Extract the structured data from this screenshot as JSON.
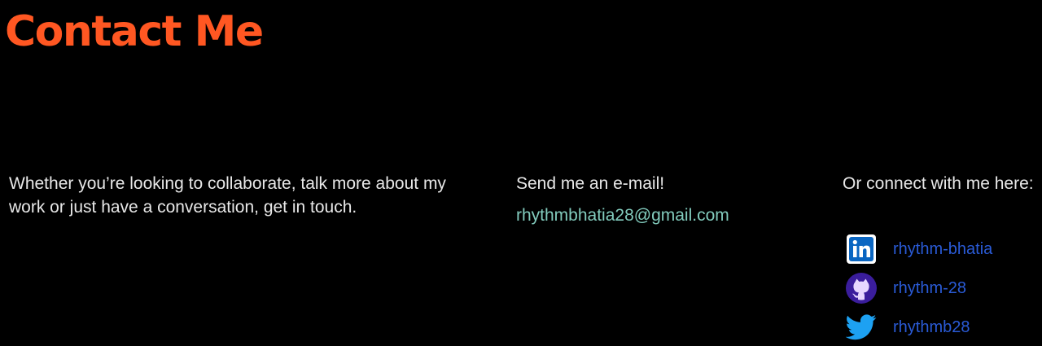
{
  "header": {
    "title": "Contact Me"
  },
  "intro": {
    "text": "Whether you’re looking to collaborate, talk more about my work or just have a conversation, get in touch."
  },
  "email": {
    "heading": "Send me an e-mail!",
    "address": "rhythmbhatia28@gmail.com"
  },
  "connect": {
    "heading": "Or connect with me here:",
    "links": [
      {
        "icon": "linkedin-icon",
        "label": "rhythm-bhatia"
      },
      {
        "icon": "github-icon",
        "label": "rhythm-28"
      },
      {
        "icon": "twitter-icon",
        "label": "rhythmb28"
      }
    ]
  },
  "colors": {
    "background": "#000000",
    "title": "#ff5722",
    "body_text": "#e8e8e8",
    "email_link": "#82cbbd",
    "social_link": "#2a5bd7",
    "linkedin_brand": "#0a66c2",
    "github_brand": "#3a1d9c",
    "twitter_brand": "#1da1f2"
  }
}
